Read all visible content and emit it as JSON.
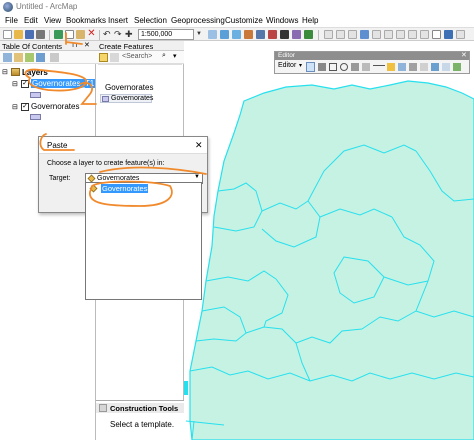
{
  "window": {
    "title": "Untitled - ArcMap"
  },
  "menu": [
    "File",
    "Edit",
    "View",
    "Bookmarks",
    "Insert",
    "Selection",
    "Geoprocessing",
    "Customize",
    "Windows",
    "Help"
  ],
  "toolbar": {
    "scale": "1:500,000"
  },
  "toc": {
    "title": "Table Of Contents",
    "root_label": "Layers",
    "layers": [
      {
        "label": "Governorates_T1",
        "checked": true,
        "selected": true
      },
      {
        "label": "Governorates",
        "checked": true,
        "selected": false
      }
    ]
  },
  "create_features": {
    "title": "Create Features",
    "search_placeholder": "<Search>",
    "group_label": "Governorates",
    "template_label": "Governorates",
    "construction_tools_title": "Construction Tools",
    "construction_hint": "Select a template."
  },
  "editor": {
    "title": "Editor",
    "menu_label": "Editor"
  },
  "paste_dialog": {
    "title": "Paste",
    "prompt": "Choose a layer to create feature(s) in:",
    "target_label": "Target:",
    "target_value": "Governorates",
    "options": [
      "Governorates"
    ]
  },
  "colors": {
    "map_fill": "#c5f2e3",
    "map_border": "#27e0ee",
    "annotation": "#f08a2c",
    "selection": "#3399ff"
  }
}
